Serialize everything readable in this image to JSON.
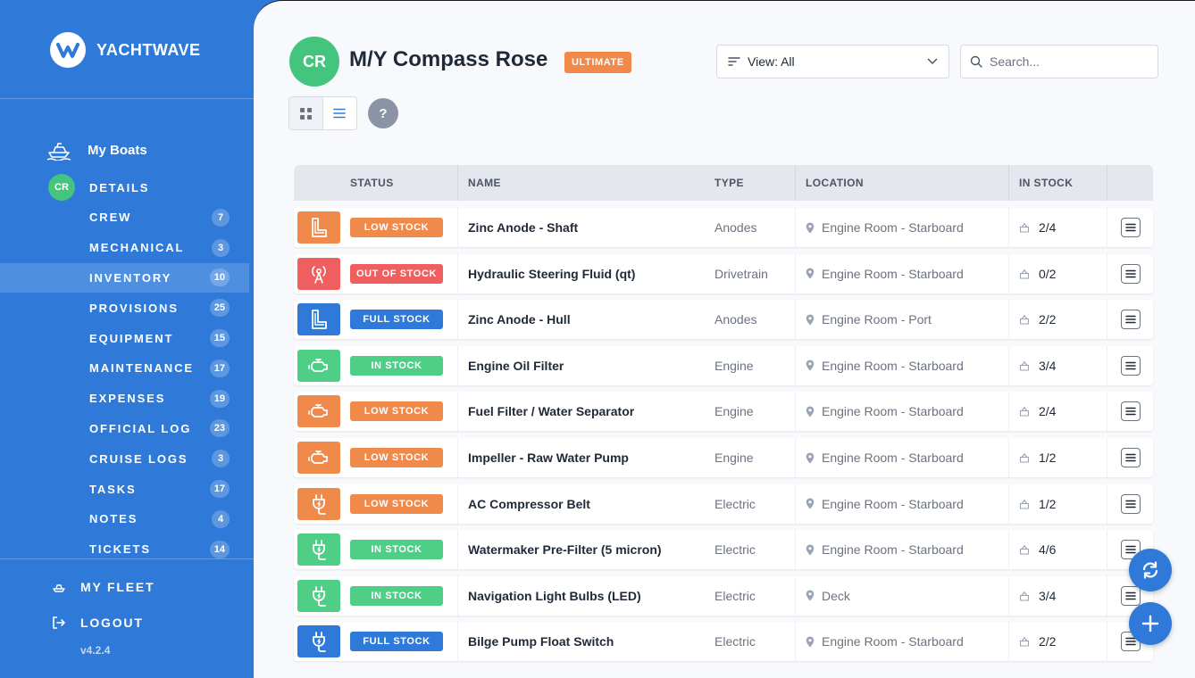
{
  "brand": {
    "name": "YACHTWAVE"
  },
  "sidebar": {
    "my_boats": "My Boats",
    "details_avatar": "CR",
    "details": "DETAILS",
    "items": [
      {
        "label": "CREW",
        "count": "7"
      },
      {
        "label": "MECHANICAL",
        "count": "3"
      },
      {
        "label": "INVENTORY",
        "count": "10"
      },
      {
        "label": "PROVISIONS",
        "count": "25"
      },
      {
        "label": "EQUIPMENT",
        "count": "15"
      },
      {
        "label": "MAINTENANCE",
        "count": "17"
      },
      {
        "label": "EXPENSES",
        "count": "19"
      },
      {
        "label": "OFFICIAL LOG",
        "count": "23"
      },
      {
        "label": "CRUISE LOGS",
        "count": "3"
      },
      {
        "label": "TASKS",
        "count": "17"
      },
      {
        "label": "NOTES",
        "count": "4"
      },
      {
        "label": "TICKETS",
        "count": "14"
      }
    ],
    "active_item": "INVENTORY",
    "my_fleet": "MY FLEET",
    "logout": "LOGOUT",
    "version": "v4.2.4"
  },
  "header": {
    "avatar": "CR",
    "title": "M/Y Compass Rose",
    "tier": "ULTIMATE",
    "view_select": "View: All",
    "search_placeholder": "Search...",
    "help": "?"
  },
  "colors": {
    "low": "#f08a4b",
    "out": "#ef5f5f",
    "full": "#2f7ad8",
    "in": "#4fcf86"
  },
  "table": {
    "headers": {
      "status": "STATUS",
      "name": "NAME",
      "type": "TYPE",
      "location": "LOCATION",
      "stock": "IN STOCK"
    },
    "rows": [
      {
        "icon": "anode-icon",
        "status": "LOW STOCK",
        "level": "low",
        "name": "Zinc Anode - Shaft",
        "type": "Anodes",
        "location": "Engine Room - Starboard",
        "stock": "2/4"
      },
      {
        "icon": "steering-icon",
        "status": "OUT OF STOCK",
        "level": "out",
        "name": "Hydraulic Steering Fluid (qt)",
        "type": "Drivetrain",
        "location": "Engine Room - Starboard",
        "stock": "0/2"
      },
      {
        "icon": "anode-icon",
        "status": "FULL STOCK",
        "level": "full",
        "name": "Zinc Anode - Hull",
        "type": "Anodes",
        "location": "Engine Room - Port",
        "stock": "2/2"
      },
      {
        "icon": "engine-icon",
        "status": "IN STOCK",
        "level": "in",
        "name": "Engine Oil Filter",
        "type": "Engine",
        "location": "Engine Room - Starboard",
        "stock": "3/4"
      },
      {
        "icon": "engine-icon",
        "status": "LOW STOCK",
        "level": "low",
        "name": "Fuel Filter / Water Separator",
        "type": "Engine",
        "location": "Engine Room - Starboard",
        "stock": "2/4"
      },
      {
        "icon": "engine-icon",
        "status": "LOW STOCK",
        "level": "low",
        "name": "Impeller - Raw Water Pump",
        "type": "Engine",
        "location": "Engine Room - Starboard",
        "stock": "1/2"
      },
      {
        "icon": "plug-icon",
        "status": "LOW STOCK",
        "level": "low",
        "name": "AC Compressor Belt",
        "type": "Electric",
        "location": "Engine Room - Starboard",
        "stock": "1/2"
      },
      {
        "icon": "plug-icon",
        "status": "IN STOCK",
        "level": "in",
        "name": "Watermaker Pre-Filter (5 micron)",
        "type": "Electric",
        "location": "Engine Room - Starboard",
        "stock": "4/6"
      },
      {
        "icon": "plug-icon",
        "status": "IN STOCK",
        "level": "in",
        "name": "Navigation Light Bulbs (LED)",
        "type": "Electric",
        "location": "Deck",
        "stock": "3/4"
      },
      {
        "icon": "plug-icon",
        "status": "FULL STOCK",
        "level": "full",
        "name": "Bilge Pump Float Switch",
        "type": "Electric",
        "location": "Engine Room - Starboard",
        "stock": "2/2"
      }
    ]
  },
  "fabs": {
    "refresh": "refresh-icon",
    "add": "plus-icon"
  }
}
